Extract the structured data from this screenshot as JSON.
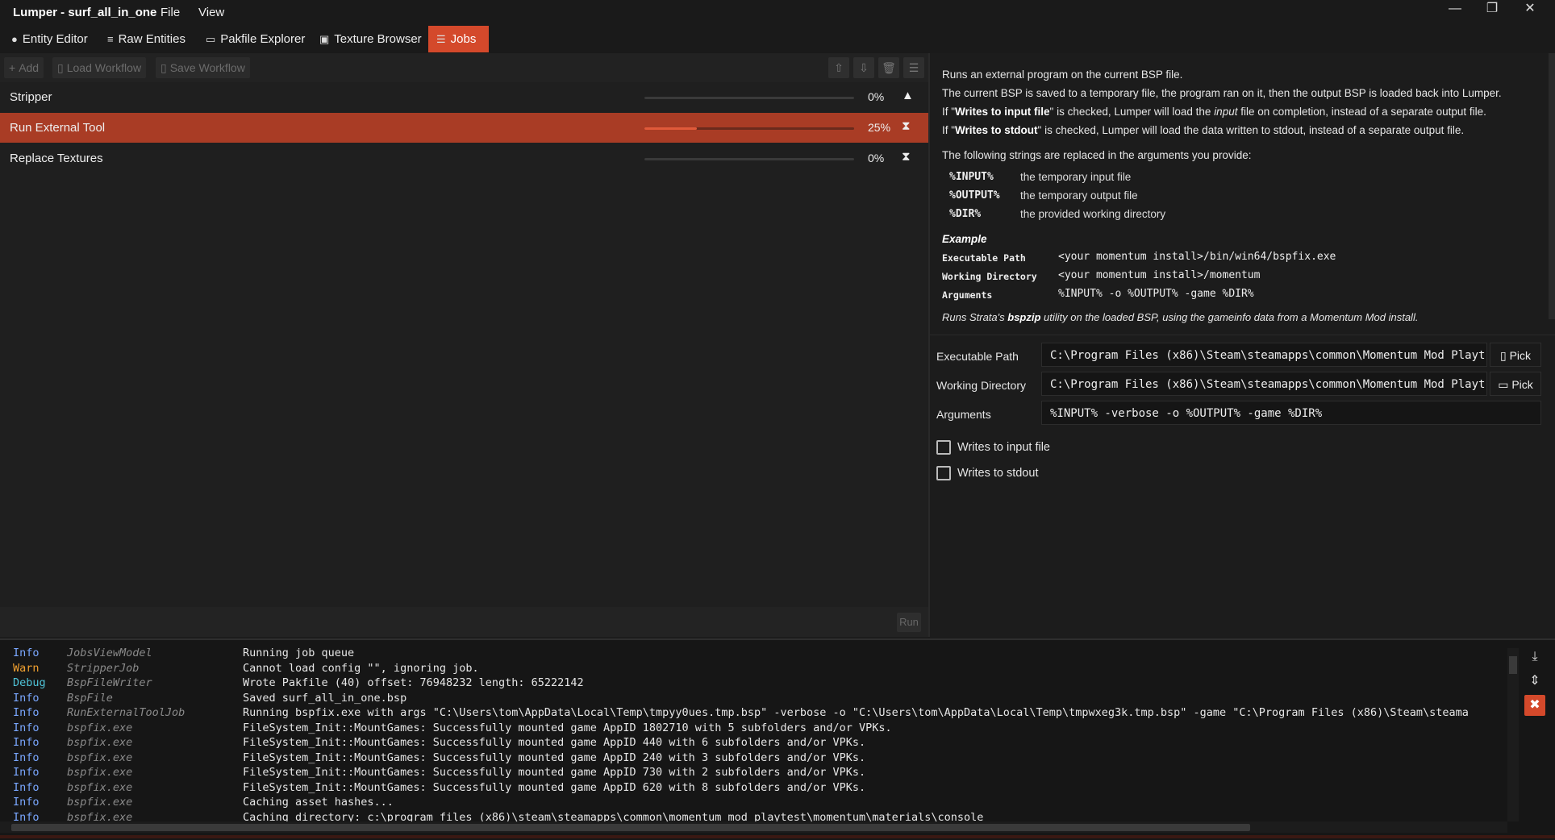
{
  "window": {
    "title": "Lumper - surf_all_in_one",
    "menu": [
      "File",
      "View"
    ],
    "controls": {
      "minimize": "—",
      "maximize": "❐",
      "close": "✕"
    }
  },
  "tabs": [
    {
      "label": "Entity Editor",
      "icon": "lightbulb-icon",
      "glyph": "●"
    },
    {
      "label": "Raw Entities",
      "icon": "list-icon",
      "glyph": "≡"
    },
    {
      "label": "Pakfile Explorer",
      "icon": "folder-icon",
      "glyph": "▭"
    },
    {
      "label": "Texture Browser",
      "icon": "image-icon",
      "glyph": "▣"
    },
    {
      "label": "Jobs",
      "icon": "jobs-icon",
      "glyph": "☰",
      "active": true
    }
  ],
  "toolbar": {
    "add": "Add",
    "load_workflow": "Load Workflow",
    "save_workflow": "Save Workflow",
    "move_up": "⇧",
    "move_down": "⇩",
    "delete": "🗑",
    "clear": "☰"
  },
  "jobs": [
    {
      "name": "Stripper",
      "progress_pct": 0,
      "progress_label": "0%",
      "status_icon": "warning-icon",
      "glyph": "▲"
    },
    {
      "name": "Run External Tool",
      "progress_pct": 25,
      "progress_label": "25%",
      "status_icon": "hourglass-icon",
      "glyph": "⧗",
      "selected": true
    },
    {
      "name": "Replace Textures",
      "progress_pct": 0,
      "progress_label": "0%",
      "status_icon": "hourglass-icon",
      "glyph": "⧗"
    }
  ],
  "run_label": "Run",
  "description": {
    "intro": "Runs an external program on the current BSP file.",
    "line2": "The current BSP is saved to a temporary file, the program ran on it, then the output BSP is loaded back into Lumper.",
    "line3_pre": "If \"",
    "line3_bold": "Writes to input file",
    "line3_mid": "\" is checked, Lumper will load the ",
    "line3_italic": "input",
    "line3_post": " file on completion, instead of a separate output file.",
    "line4_pre": "If \"",
    "line4_bold": "Writes to stdout",
    "line4_post": "\" is checked, Lumper will load the data written to stdout, instead of a separate output file.",
    "strings_intro": "The following strings are replaced in the arguments you provide:",
    "tokens": [
      {
        "token": "%INPUT%",
        "desc": "the temporary input file"
      },
      {
        "token": "%OUTPUT%",
        "desc": "the temporary output file"
      },
      {
        "token": "%DIR%",
        "desc": "the provided working directory"
      }
    ],
    "example_title": "Example",
    "example": [
      {
        "key": "Executable Path",
        "value": "<your momentum install>/bin/win64/bspfix.exe"
      },
      {
        "key": "Working Directory",
        "value": "<your momentum install>/momentum"
      },
      {
        "key": "Arguments",
        "value": "%INPUT% -o %OUTPUT% -game %DIR%"
      }
    ],
    "example_note_pre": "Runs Strata's ",
    "example_note_bold": "bspzip",
    "example_note_post": " utility on the loaded BSP, using the gameinfo data from a Momentum Mod install."
  },
  "form": {
    "exe_label": "Executable Path",
    "exe_value": "C:\\Program Files (x86)\\Steam\\steamapps\\common\\Momentum Mod Playt",
    "workdir_label": "Working Directory",
    "workdir_value": "C:\\Program Files (x86)\\Steam\\steamapps\\common\\Momentum Mod Playt",
    "args_label": "Arguments",
    "args_value": "%INPUT% -verbose -o %OUTPUT% -game %DIR%",
    "pick": "Pick",
    "writes_input_label": "Writes to input file",
    "writes_input_checked": false,
    "writes_stdout_label": "Writes to stdout",
    "writes_stdout_checked": false
  },
  "log": [
    {
      "level": "Info",
      "source": "JobsViewModel",
      "message": "Running job queue"
    },
    {
      "level": "Warn",
      "source": "StripperJob",
      "message": "Cannot load config \"\", ignoring job."
    },
    {
      "level": "Debug",
      "source": "BspFileWriter",
      "message": "Wrote Pakfile (40)                          offset: 76948232        length: 65222142"
    },
    {
      "level": "Info",
      "source": "BspFile",
      "message": "Saved surf_all_in_one.bsp"
    },
    {
      "level": "Info",
      "source": "RunExternalToolJob",
      "message": "Running bspfix.exe with args \"C:\\Users\\tom\\AppData\\Local\\Temp\\tmpyy0ues.tmp.bsp\" -verbose -o \"C:\\Users\\tom\\AppData\\Local\\Temp\\tmpwxeg3k.tmp.bsp\" -game \"C:\\Program Files (x86)\\Steam\\steama"
    },
    {
      "level": "Info",
      "source": "bspfix.exe",
      "message": "FileSystem_Init::MountGames: Successfully mounted game AppID 1802710 with 5 subfolders and/or VPKs."
    },
    {
      "level": "Info",
      "source": "bspfix.exe",
      "message": "FileSystem_Init::MountGames: Successfully mounted game AppID 440 with 6 subfolders and/or VPKs."
    },
    {
      "level": "Info",
      "source": "bspfix.exe",
      "message": "FileSystem_Init::MountGames: Successfully mounted game AppID 240 with 3 subfolders and/or VPKs."
    },
    {
      "level": "Info",
      "source": "bspfix.exe",
      "message": "FileSystem_Init::MountGames: Successfully mounted game AppID 730 with 2 subfolders and/or VPKs."
    },
    {
      "level": "Info",
      "source": "bspfix.exe",
      "message": "FileSystem_Init::MountGames: Successfully mounted game AppID 620 with 8 subfolders and/or VPKs."
    },
    {
      "level": "Info",
      "source": "bspfix.exe",
      "message": "Caching asset hashes..."
    },
    {
      "level": "Info",
      "source": "bspfix.exe",
      "message": "Caching directory: c:\\program files (x86)\\steam\\steamapps\\common\\momentum mod playtest\\momentum\\materials\\console"
    }
  ],
  "log_tools": {
    "scroll_to_end": "⤓",
    "lock_scroll": "⇕",
    "clear": "✖"
  },
  "colors": {
    "accent": "#d4492b",
    "selected_row": "#a93c25",
    "info": "#7aa7ff",
    "warn": "#f0a030",
    "debug": "#4fc4d8"
  }
}
